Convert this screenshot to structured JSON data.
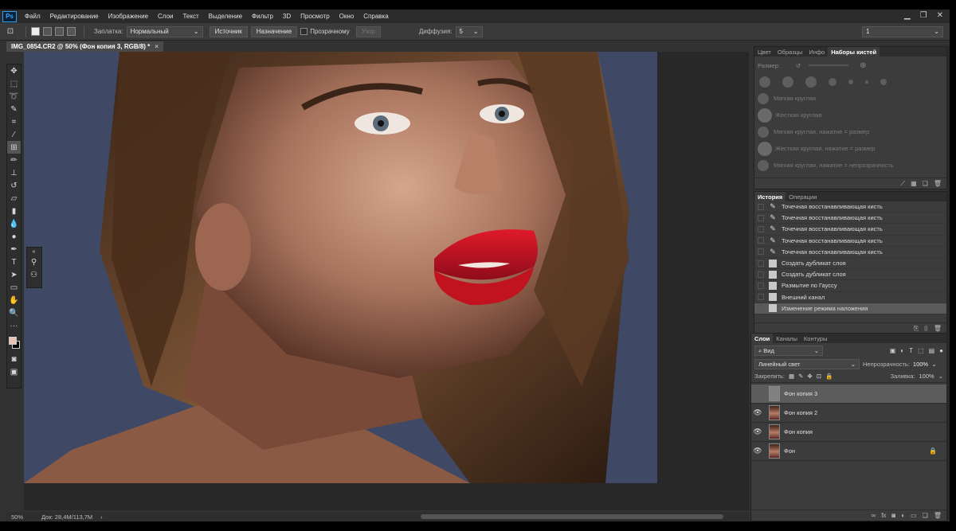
{
  "app": {
    "logo": "Ps"
  },
  "menu": [
    "Файл",
    "Редактирование",
    "Изображение",
    "Слои",
    "Текст",
    "Выделение",
    "Фильтр",
    "3D",
    "Просмотр",
    "Окно",
    "Справка"
  ],
  "options": {
    "patch_label": "Заплатка:",
    "patch_mode": "Нормальный",
    "source_label": "Источник",
    "destination_label": "Назначение",
    "transparent_label": "Прозрачному",
    "pattern_label": "Узор",
    "diffusion_label": "Диффузия:",
    "diffusion_value": "5",
    "workspace_value": "1"
  },
  "document": {
    "tab_title": "IMG_0854.CR2 @ 50% (Фон копия 3, RGB/8) *",
    "zoom": "50%",
    "doc_size": "Док: 28,4M/113,7M"
  },
  "brush_panel": {
    "tabs": [
      "Цвет",
      "Образцы",
      "Инфо",
      "Наборы кистей"
    ],
    "size_label": "Размер:",
    "presets": [
      "Мягкая круглая",
      "Жесткая круглая",
      "Мягкая круглая, нажатие = размер",
      "Жесткая круглая, нажатие = размер",
      "Мягкая круглая, нажатие = непрозрачность"
    ]
  },
  "history_panel": {
    "tabs": [
      "История",
      "Операции"
    ],
    "items": [
      {
        "label": "Точечная восстанавливающая кисть",
        "icon": "brush"
      },
      {
        "label": "Точечная восстанавливающая кисть",
        "icon": "brush"
      },
      {
        "label": "Точечная восстанавливающая кисть",
        "icon": "brush"
      },
      {
        "label": "Точечная восстанавливающая кисть",
        "icon": "brush"
      },
      {
        "label": "Точечная восстанавливающая кисть",
        "icon": "brush"
      },
      {
        "label": "Создать дубликат слоя",
        "icon": "doc"
      },
      {
        "label": "Создать дубликат слоя",
        "icon": "doc"
      },
      {
        "label": "Размытие по Гауссу",
        "icon": "doc"
      },
      {
        "label": "Внешний канал",
        "icon": "doc"
      },
      {
        "label": "Изменение режима наложения",
        "icon": "doc"
      }
    ]
  },
  "layers_panel": {
    "tabs": [
      "Слои",
      "Каналы",
      "Контуры"
    ],
    "filter_kind": "Вид",
    "blend_mode": "Линейный свет",
    "opacity_label": "Непрозрачность:",
    "opacity_value": "100%",
    "lock_label": "Закрепить:",
    "fill_label": "Заливка:",
    "fill_value": "100%",
    "layers": [
      {
        "name": "Фон копия 3",
        "visible": false,
        "thumb": "gray",
        "locked": false
      },
      {
        "name": "Фон копия 2",
        "visible": true,
        "thumb": "face",
        "locked": false
      },
      {
        "name": "Фон копия",
        "visible": true,
        "thumb": "face",
        "locked": false
      },
      {
        "name": "Фон",
        "visible": true,
        "thumb": "face",
        "locked": true
      }
    ]
  },
  "colors": {
    "foreground": "#e8c4b8",
    "background": "#000000",
    "accent": "#31a8ff"
  }
}
